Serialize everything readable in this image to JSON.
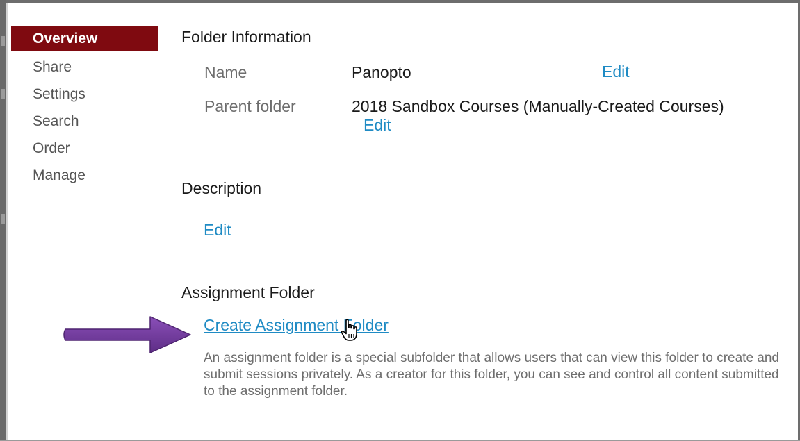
{
  "sidebar": {
    "items": [
      {
        "label": "Overview",
        "active": true
      },
      {
        "label": "Share"
      },
      {
        "label": "Settings"
      },
      {
        "label": "Search"
      },
      {
        "label": "Order"
      },
      {
        "label": "Manage"
      }
    ]
  },
  "folder_info": {
    "title": "Folder Information",
    "name_label": "Name",
    "name_value": "Panopto",
    "name_edit": "Edit",
    "parent_label": "Parent folder",
    "parent_value": "2018 Sandbox Courses (Manually-Created Courses)",
    "parent_edit": "Edit"
  },
  "description": {
    "title": "Description",
    "edit": "Edit"
  },
  "assignment": {
    "title": "Assignment Folder",
    "create_link": "Create Assignment Folder",
    "help_text": "An assignment folder is a special subfolder that allows users that can view this folder to create and submit sessions privately. As a creator for this folder, you can see and control all content submitted to the assignment folder."
  },
  "colors": {
    "active_nav": "#7f0a10",
    "link": "#1f8bc4",
    "annotation_arrow": "#6d3a96"
  },
  "icons": {
    "annotation": "arrow-right-icon",
    "pointer": "hand-pointer-icon"
  }
}
